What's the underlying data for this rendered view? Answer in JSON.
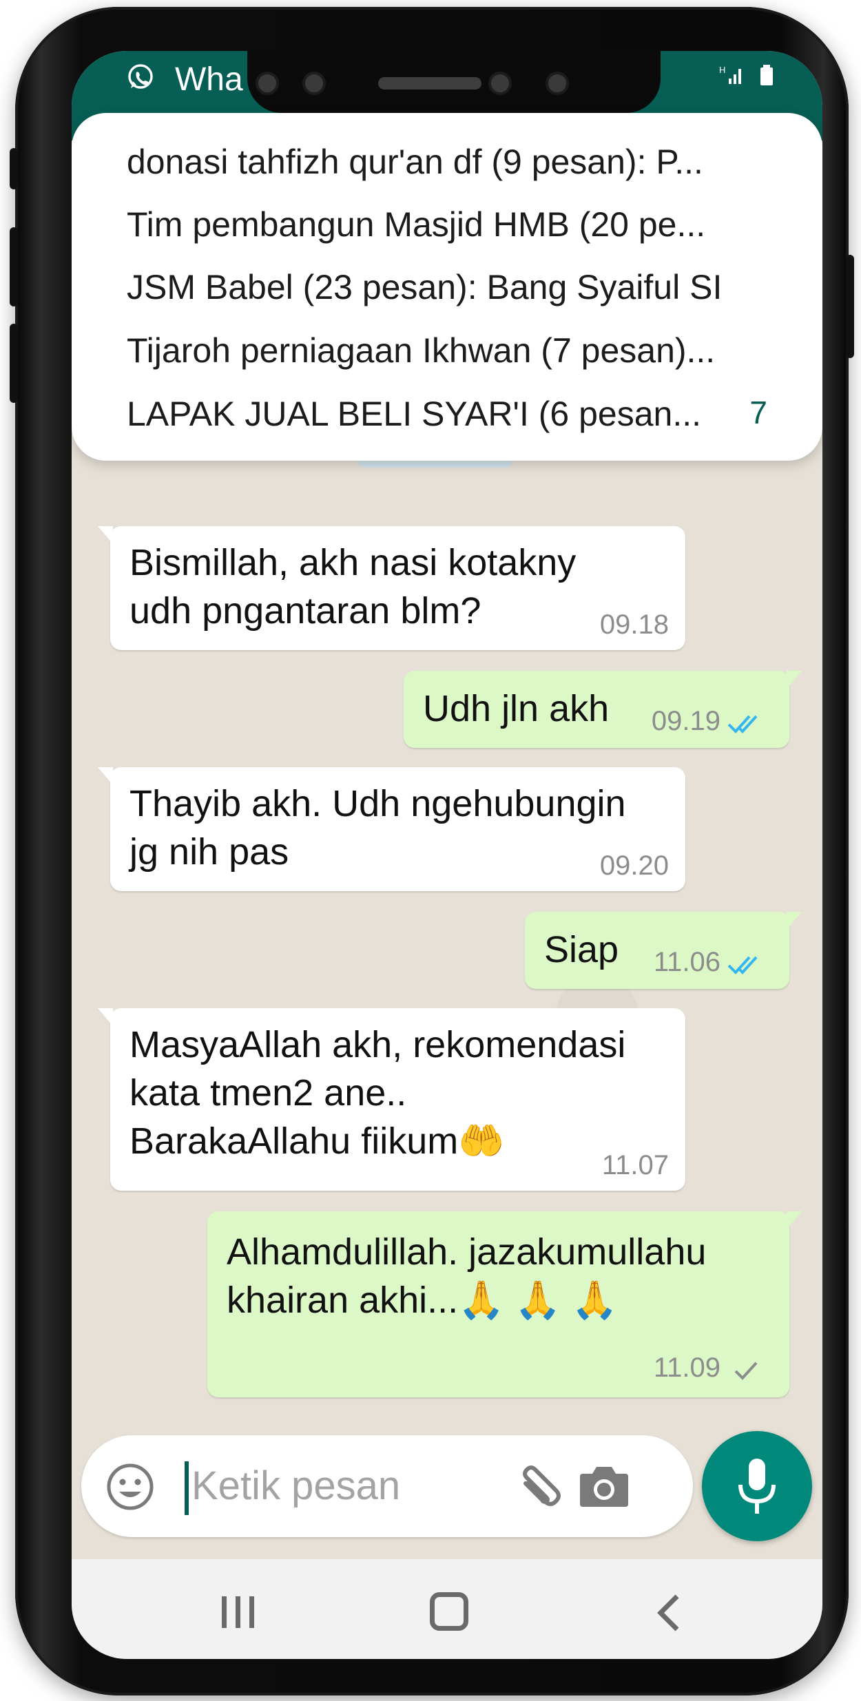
{
  "header": {
    "title": "Wha"
  },
  "notification": {
    "lines": [
      "donasi tahfizh qur'an df (9 pesan): P...",
      "Tim pembangun Masjid HMB (20 pe...",
      "JSM Babel (23 pesan): Bang Syaiful SI",
      "Tijaroh perniagaan Ikhwan (7 pesan)...",
      "LAPAK JUAL BELI SYAR'I (6 pesan..."
    ],
    "count": "7"
  },
  "messages": [
    {
      "direction": "in",
      "text": "Bismillah, akh nasi kotakny\nudh pngantaran blm?",
      "time": "09.18"
    },
    {
      "direction": "out",
      "text": "Udh jln akh",
      "time": "09.19",
      "status": "read"
    },
    {
      "direction": "in",
      "text": "Thayib akh. Udh ngehubungin\njg nih pas",
      "time": "09.20"
    },
    {
      "direction": "out",
      "text": "Siap",
      "time": "11.06",
      "status": "read"
    },
    {
      "direction": "in",
      "text": "MasyaAllah akh, rekomendasi\nkata tmen2 ane..\nBarakaAllahu fiikum🤲",
      "time": "11.07"
    },
    {
      "direction": "out",
      "text": "Alhamdulillah. jazakumullahu\nkhairan akhi...🙏 🙏 🙏",
      "time": "11.09",
      "status": "sent"
    }
  ],
  "input": {
    "placeholder": "Ketik pesan"
  },
  "colors": {
    "header": "#075e54",
    "outgoing_bubble": "#dcf8c6",
    "incoming_bubble": "#ffffff",
    "read_tick": "#34b7f1",
    "mic_button": "#00897b"
  },
  "icons": [
    "whatsapp-icon",
    "signal-icon",
    "battery-icon",
    "emoji-icon",
    "paperclip-icon",
    "camera-icon",
    "mic-icon",
    "nav-recents-icon",
    "nav-home-icon",
    "nav-back-icon"
  ]
}
